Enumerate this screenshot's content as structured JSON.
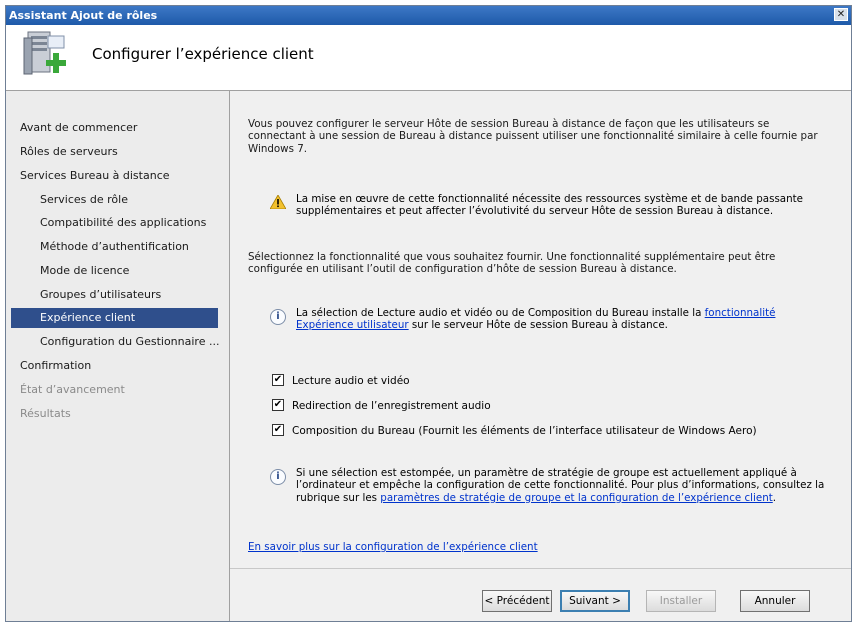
{
  "window": {
    "title": "Assistant Ajout de rôles",
    "close_symbol": "✕"
  },
  "header": {
    "title": "Configurer l’expérience client",
    "icon": "server-add-icon"
  },
  "sidebar": {
    "items": [
      {
        "label": "Avant de commencer"
      },
      {
        "label": "Rôles de serveurs"
      },
      {
        "label": "Services Bureau à distance"
      },
      {
        "label": "Services de rôle"
      },
      {
        "label": "Compatibilité des applications"
      },
      {
        "label": "Méthode d’authentification"
      },
      {
        "label": "Mode de licence"
      },
      {
        "label": "Groupes d’utilisateurs"
      },
      {
        "label": "Expérience client"
      },
      {
        "label": "Configuration du Gestionnaire ..."
      },
      {
        "label": "Confirmation"
      },
      {
        "label": "État d’avancement"
      },
      {
        "label": "Résultats"
      }
    ]
  },
  "main": {
    "intro": "Vous pouvez configurer le serveur Hôte de session Bureau à distance de façon que les utilisateurs se connectant à une session de Bureau à distance puissent utiliser une fonctionnalité similaire à celle fournie par Windows 7.",
    "warning": "La mise en œuvre de cette fonctionnalité nécessite des ressources système et de bande passante supplémentaires et peut affecter l’évolutivité du serveur Hôte de session Bureau à distance.",
    "select_text": "Sélectionnez la fonctionnalité que vous souhaitez fournir. Une fonctionnalité supplémentaire peut être configurée en utilisant l’outil de configuration d’hôte de session Bureau à distance.",
    "info1_before": "La sélection de Lecture audio et vidéo ou de Composition du Bureau installe la ",
    "info1_link": "fonctionnalité Expérience utilisateur",
    "info1_after": " sur le serveur Hôte de session Bureau à distance.",
    "checkboxes": [
      {
        "label": "Lecture audio et vidéo",
        "checked": true,
        "mark": "✔"
      },
      {
        "label": "Redirection de l’enregistrement audio",
        "checked": true,
        "mark": "✔"
      },
      {
        "label": "Composition du Bureau (Fournit les éléments de l’interface utilisateur de Windows Aero)",
        "checked": true,
        "mark": "✔"
      }
    ],
    "info2_before": "Si une sélection est estompée, un paramètre de stratégie de groupe est actuellement appliqué à l’ordinateur et empêche la configuration de cette fonctionnalité. Pour plus d’informations, consultez la rubrique sur les ",
    "info2_link": "paramètres de stratégie de groupe et la configuration de l’expérience client",
    "info2_after": ".",
    "learn_more": "En savoir plus sur la configuration de l’expérience client",
    "info_symbol": "i"
  },
  "footer": {
    "previous": "< Précédent",
    "next": "Suivant >",
    "install": "Installer",
    "cancel": "Annuler"
  }
}
